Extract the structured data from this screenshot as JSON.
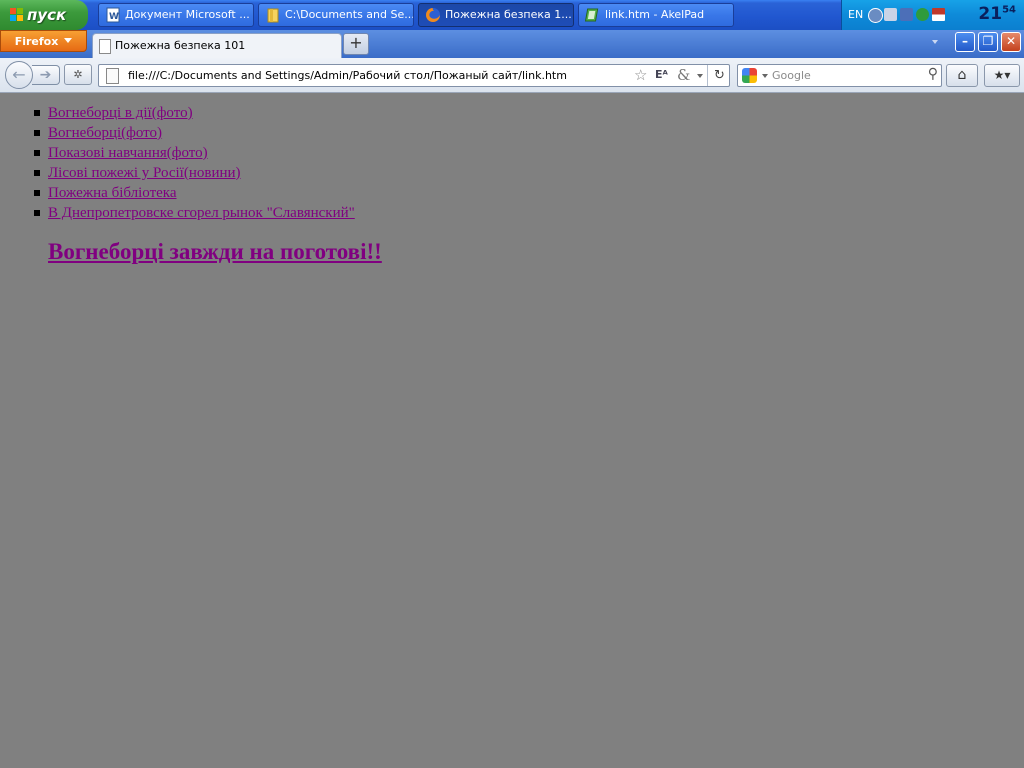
{
  "taskbar": {
    "start_label": "пуск",
    "tasks": [
      {
        "label": "Документ Microsoft ...",
        "icon": "word-document-icon",
        "active": false
      },
      {
        "label": "C:\\Documents and Se...",
        "icon": "folder-icon",
        "active": false
      },
      {
        "label": "Пожежна безпека 1...",
        "icon": "firefox-icon",
        "active": true
      },
      {
        "label": "link.htm - AkelPad",
        "icon": "notepad-icon",
        "active": false
      }
    ],
    "tray": {
      "language": "EN",
      "clock_hour": "21",
      "clock_minute": "54"
    }
  },
  "browser": {
    "menu_button": "Firefox",
    "tab_title": "Пожежна безпека 101",
    "new_tab_symbol": "+",
    "url": "file:///C:/Documents and Settings/Admin/Рабочий стол/Пожаный сайт/link.htm",
    "search_placeholder": "Google",
    "window_controls": {
      "minimize": "–",
      "restore": "❐",
      "close": "✕"
    }
  },
  "page": {
    "links": [
      "Вогнеборці в дії(фото)",
      "Вогнеборці(фото)",
      "Показові навчання(фото)",
      "Лісові пожежі у Росії(новини)",
      "Пожежна бібліотека",
      "В Днепропетровске сгорел рынок \"Славянский\""
    ],
    "heading": "Вогнеборці завжди на поготові!!"
  },
  "colors": {
    "page_background": "#808080",
    "link_color": "#800080"
  }
}
